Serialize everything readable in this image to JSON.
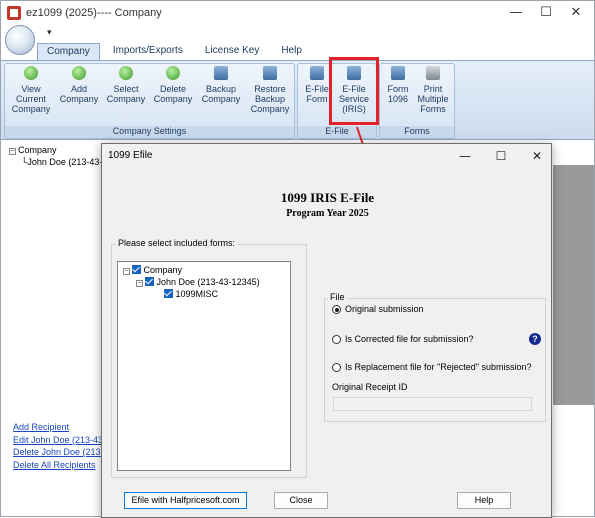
{
  "app": {
    "title": "ez1099 (2025)---- Company",
    "qat_glyph": "▾",
    "window_controls": {
      "minimize": "—",
      "maximize": "☐",
      "close": "✕"
    }
  },
  "ribbon": {
    "tabs": [
      {
        "label": "Company",
        "active": true
      },
      {
        "label": "Imports/Exports",
        "active": false
      },
      {
        "label": "License Key",
        "active": false
      },
      {
        "label": "Help",
        "active": false
      }
    ],
    "groups": {
      "company_settings": {
        "label": "Company Settings",
        "buttons": [
          {
            "label": "View Current Company",
            "lines": [
              "View",
              "Current",
              "Company"
            ],
            "icon": "green-circle-icon"
          },
          {
            "label": "Add Company",
            "lines": [
              "Add",
              "Company"
            ],
            "icon": "green-circle-plus-icon"
          },
          {
            "label": "Select Company",
            "lines": [
              "Select",
              "Company"
            ],
            "icon": "green-circle-icon"
          },
          {
            "label": "Delete Company",
            "lines": [
              "Delete",
              "Company"
            ],
            "icon": "green-circle-minus-icon"
          },
          {
            "label": "Backup Company",
            "lines": [
              "Backup",
              "Company"
            ],
            "icon": "floppy-disk-icon"
          },
          {
            "label": "Restore Backup Company",
            "lines": [
              "Restore",
              "Backup",
              "Company"
            ],
            "icon": "floppy-disk-icon"
          }
        ]
      },
      "efile": {
        "label": "E-File",
        "buttons": [
          {
            "label": "E-File Form",
            "lines": [
              "E-File",
              "Form"
            ],
            "icon": "efile-form-icon"
          },
          {
            "label": "E-File Service (IRIS)",
            "lines": [
              "E-File",
              "Service",
              "(IRIS)"
            ],
            "icon": "efile-service-icon"
          }
        ]
      },
      "forms": {
        "label": "Forms",
        "buttons": [
          {
            "label": "Form 1096",
            "lines": [
              "Form",
              "1096"
            ],
            "icon": "form-arrow-icon"
          },
          {
            "label": "Print Multiple Forms",
            "lines": [
              "Print",
              "Multiple",
              "Forms"
            ],
            "icon": "printer-icon"
          }
        ]
      }
    }
  },
  "left_panel": {
    "tree": [
      {
        "label": "Company"
      },
      {
        "label": "John Doe (213-43-"
      }
    ],
    "links": [
      "Add Recipient",
      "Edit John Doe (213-43-12",
      "Delete John Doe (213-43",
      "Delete All Recipients"
    ]
  },
  "dialog": {
    "title": "1099 Efile",
    "heading": "1099 IRIS E-File",
    "subheading": "Program Year 2025",
    "forms_group_label": "Please select included forms:",
    "tree": [
      {
        "label": "Company",
        "checked": true
      },
      {
        "label": "John Doe (213-43-12345)",
        "checked": true
      },
      {
        "label": "1099MISC",
        "checked": true
      }
    ],
    "file_group": {
      "label": "File",
      "options": [
        {
          "label": "Original submission",
          "selected": true
        },
        {
          "label": "Is Corrected file for  submission?",
          "selected": false
        },
        {
          "label": "Is Replacement file for \"Rejected\" submission?",
          "selected": false
        }
      ],
      "help_glyph": "?",
      "receipt_label": "Original Receipt ID",
      "receipt_value": ""
    },
    "buttons": {
      "efile": "Efile with Halfpricesoft.com",
      "close": "Close",
      "help": "Help"
    },
    "window_controls": {
      "minimize": "—",
      "maximize": "☐",
      "close": "✕"
    }
  },
  "colors": {
    "ribbon_bg": "#cddcee",
    "highlight_box": "#e2232a",
    "arrow": "#e2232a",
    "checkbox": "#1565c0",
    "link": "#1a47c0"
  }
}
